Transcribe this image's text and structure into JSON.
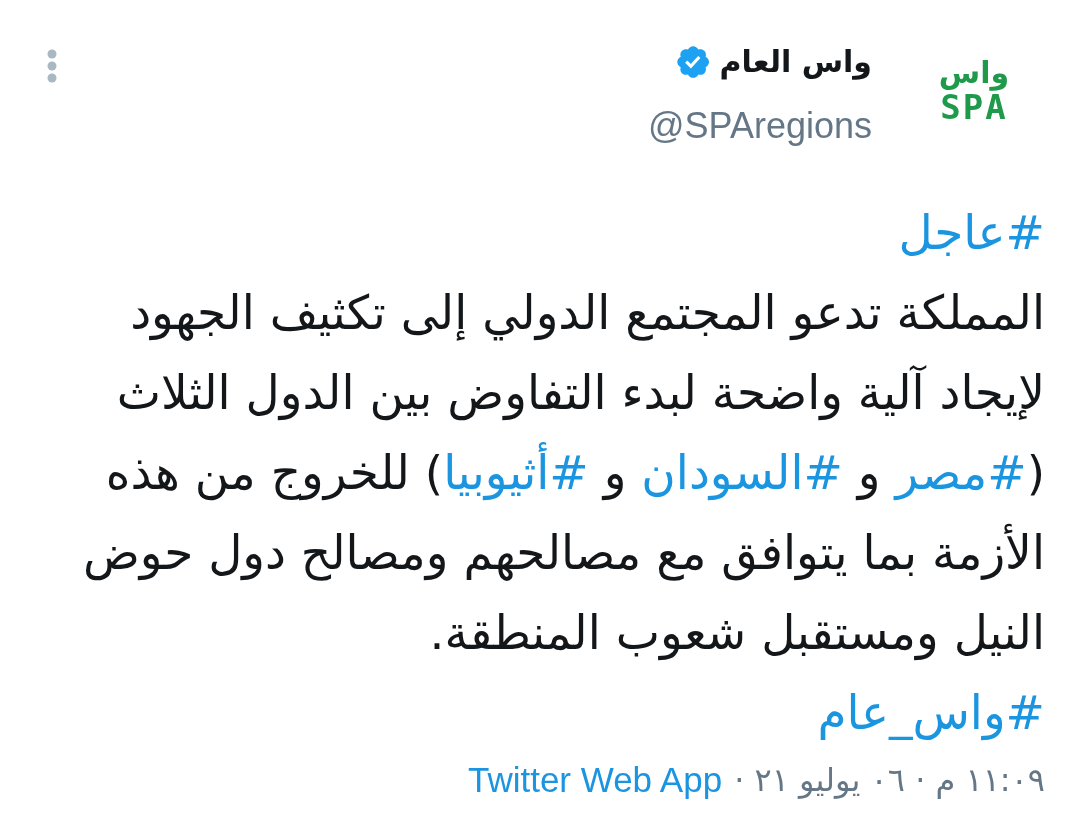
{
  "header": {
    "display_name": "واس العام",
    "verified": true,
    "handle": "@SPAregions",
    "logo": {
      "top": "واس",
      "bottom": "SPA"
    }
  },
  "tweet": {
    "lines": [
      [
        {
          "kind": "hashtag",
          "text": "#عاجل"
        }
      ],
      [
        {
          "kind": "text",
          "text": "المملكة تدعو المجتمع الدولي إلى تكثيف الجهود"
        }
      ],
      [
        {
          "kind": "text",
          "text": "لإيجاد آلية واضحة لبدء التفاوض بين الدول الثلاث"
        }
      ],
      [
        {
          "kind": "text",
          "text": "("
        },
        {
          "kind": "hashtag",
          "text": "#مصر"
        },
        {
          "kind": "text",
          "text": " و "
        },
        {
          "kind": "hashtag",
          "text": "#السودان"
        },
        {
          "kind": "text",
          "text": " و "
        },
        {
          "kind": "hashtag",
          "text": "#أثيوبيا"
        },
        {
          "kind": "text",
          "text": ") للخروج من هذه"
        }
      ],
      [
        {
          "kind": "text",
          "text": "الأزمة بما يتوافق مع مصالحهم ومصالح دول حوض"
        }
      ],
      [
        {
          "kind": "text",
          "text": "النيل ومستقبل شعوب المنطقة."
        }
      ],
      [
        {
          "kind": "hashtag",
          "text": "#واس_عام"
        }
      ]
    ]
  },
  "meta": {
    "timestamp": "١١:٠٩ م · ٠٦ يوليو ٢١ ·",
    "source": "Twitter Web App"
  }
}
